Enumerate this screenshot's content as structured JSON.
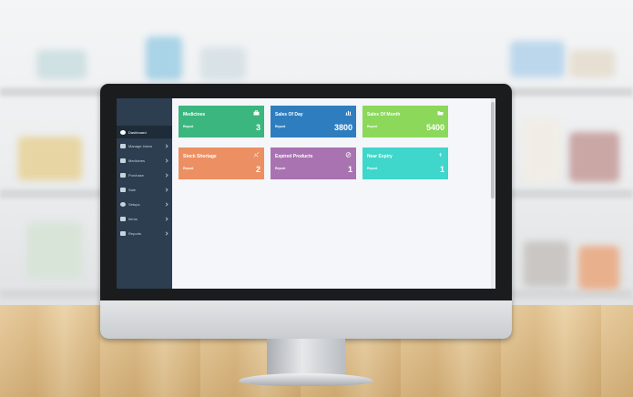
{
  "sidebar": {
    "items": [
      {
        "label": "Dashboard",
        "icon": "dashboard-icon",
        "active": true
      },
      {
        "label": "Manage Users",
        "icon": "users-icon"
      },
      {
        "label": "Medicines",
        "icon": "medicine-icon"
      },
      {
        "label": "Purchase",
        "icon": "cart-icon"
      },
      {
        "label": "Sale",
        "icon": "chart-icon"
      },
      {
        "label": "Setups",
        "icon": "gear-icon"
      },
      {
        "label": "Items",
        "icon": "list-icon"
      },
      {
        "label": "Reports",
        "icon": "report-icon"
      }
    ]
  },
  "cards": [
    {
      "title": "Medicines",
      "sub": "Report",
      "value": "3",
      "color": "#3ab67e",
      "icon": "briefcase-icon"
    },
    {
      "title": "Sales Of Day",
      "sub": "Report",
      "value": "3800",
      "color": "#2e7dbf",
      "icon": "bar-chart-icon"
    },
    {
      "title": "Sales Of Month",
      "sub": "Report",
      "value": "5400",
      "color": "#8bd85a",
      "icon": "folder-icon"
    },
    {
      "title": "Stock Shortage",
      "sub": "Report",
      "value": "2",
      "color": "#ec8f62",
      "icon": "broken-link-icon"
    },
    {
      "title": "Expired Products",
      "sub": "Report",
      "value": "1",
      "color": "#a873b0",
      "icon": "ban-icon"
    },
    {
      "title": "Near Expiry",
      "sub": "Report",
      "value": "1",
      "color": "#3fd6cb",
      "icon": "bolt-icon"
    }
  ]
}
